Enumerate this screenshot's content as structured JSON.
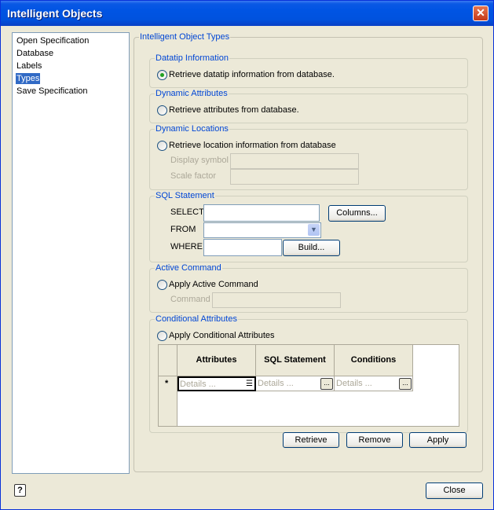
{
  "window": {
    "title": "Intelligent Objects",
    "close_glyph": "✕"
  },
  "nav": {
    "items": [
      {
        "label": "Open Specification",
        "selected": false
      },
      {
        "label": "Database",
        "selected": false
      },
      {
        "label": "Labels",
        "selected": false
      },
      {
        "label": "Types",
        "selected": true
      },
      {
        "label": "Save Specification",
        "selected": false
      }
    ]
  },
  "panel": {
    "title": "Intelligent Object Types",
    "datatip": {
      "title": "Datatip Information",
      "option": "Retrieve datatip information from database.",
      "checked": true
    },
    "dynamic_attributes": {
      "title": "Dynamic Attributes",
      "option": "Retrieve attributes from database.",
      "checked": false
    },
    "dynamic_locations": {
      "title": "Dynamic Locations",
      "option": "Retrieve location information from database",
      "checked": false,
      "display_symbol_label": "Display symbol",
      "display_symbol_value": "",
      "scale_factor_label": "Scale factor",
      "scale_factor_value": ""
    },
    "sql": {
      "title": "SQL Statement",
      "select_label": "SELECT",
      "select_value": "",
      "from_label": "FROM",
      "from_value": "",
      "where_label": "WHERE",
      "where_value": "",
      "columns_button": "Columns...",
      "build_button": "Build..."
    },
    "active_command": {
      "title": "Active Command",
      "option": "Apply Active Command",
      "checked": false,
      "command_label": "Command",
      "command_value": ""
    },
    "conditional": {
      "title": "Conditional Attributes",
      "option": "Apply Conditional Attributes",
      "checked": false,
      "columns": [
        "Attributes",
        "SQL Statement",
        "Conditions"
      ],
      "new_row_marker": "*",
      "new_row": [
        "Details ...",
        "Details ...",
        "Details ..."
      ],
      "ellipsis": "..."
    }
  },
  "buttons": {
    "retrieve": "Retrieve",
    "remove": "Remove",
    "apply": "Apply",
    "close": "Close"
  },
  "icons": {
    "help": "?",
    "combo_arrow": "▼",
    "list_glyph": "☰"
  }
}
